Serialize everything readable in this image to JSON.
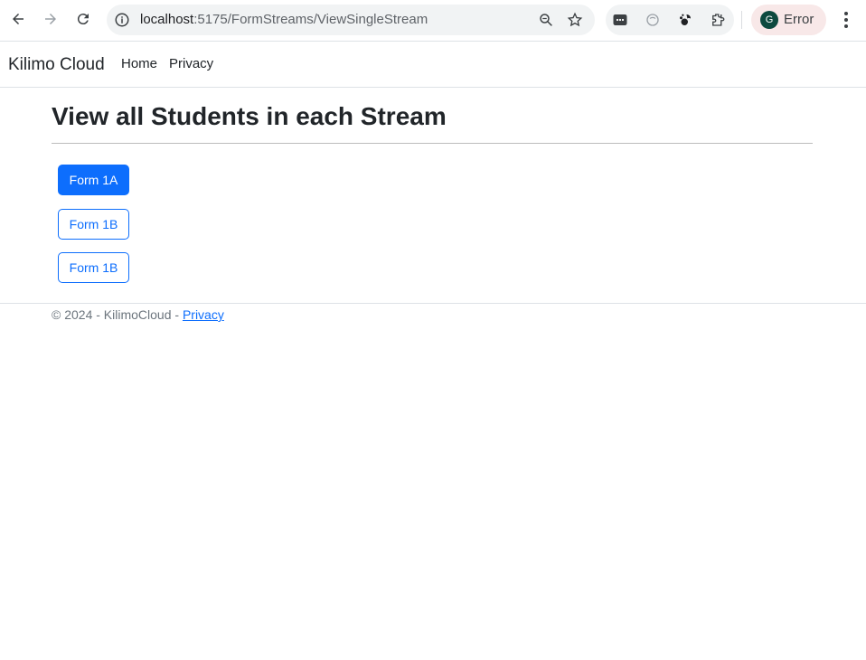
{
  "browser": {
    "url_host": "localhost",
    "url_path": ":5175/FormStreams/ViewSingleStream",
    "profile_initial": "G",
    "profile_label": "Error"
  },
  "site_nav": {
    "brand": "Kilimo Cloud",
    "links": [
      "Home",
      "Privacy"
    ]
  },
  "main": {
    "title": "View all Students in each Stream",
    "streams": [
      {
        "label": "Form 1A",
        "style": "primary"
      },
      {
        "label": "Form 1B",
        "style": "outline"
      },
      {
        "label": "Form 1B",
        "style": "outline"
      }
    ]
  },
  "footer": {
    "text": "© 2024 - KilimoCloud - ",
    "link": "Privacy"
  },
  "colors": {
    "primary": "#0d6efd",
    "text": "#212529",
    "muted": "#6c757d"
  }
}
